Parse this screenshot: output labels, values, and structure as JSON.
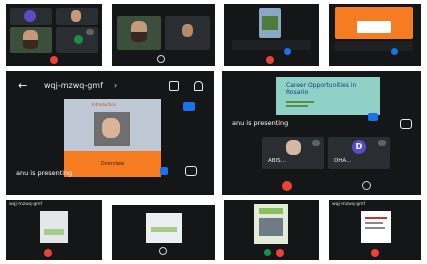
{
  "meeting": {
    "code": "wqj-mzwq-gmf",
    "presenting_text": "anu is presenting",
    "back_arrow": "←",
    "avatar_letter": "D"
  },
  "slide": {
    "title": "Career Opportunities in Rosario",
    "overview_label": "Overview",
    "intro_label": "Introduction"
  },
  "participants": {
    "first": "ABIS...",
    "second": "DHA..."
  },
  "colors": {
    "background": "#141618",
    "orange": "#f57c20",
    "blue": "#1a73e8",
    "red": "#ea4335",
    "purple": "#5b4bc4",
    "teal": "#6ac0b8"
  },
  "icons": [
    "back-arrow-icon",
    "speaker-icon",
    "more-icon",
    "expand-icon",
    "mic-off-icon",
    "end-call-icon",
    "pin-icon"
  ]
}
